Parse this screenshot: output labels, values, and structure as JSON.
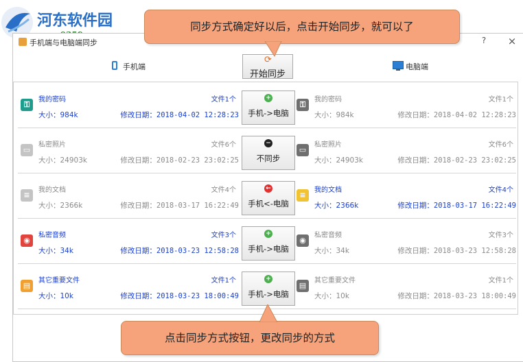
{
  "watermark": {
    "site_name": "河东软件园",
    "url": "www.pc0359.cn"
  },
  "window": {
    "title": "手机端与电脑端同步",
    "help": "?",
    "close": "×"
  },
  "header": {
    "phone_label": "手机端",
    "start_button": "开始同步",
    "pc_label": "电脑端"
  },
  "callouts": {
    "top": "同步方式确定好以后，点击开始同步，就可以了",
    "bottom": "点击同步方式按钮，更改同步的方式"
  },
  "colors": {
    "active_text": "#1a3fd0",
    "inactive_text": "#8a8a8a",
    "callout": "#f6a27a"
  },
  "rows": [
    {
      "left": {
        "name": "我的密码",
        "count": "文件1个",
        "size": "大小：984k",
        "date": "修改日期：2018-04-02 12:28:23",
        "active": true,
        "icon": "key-icon"
      },
      "sync": {
        "label": "手机->电脑",
        "icon": "plus-icon"
      },
      "right": {
        "name": "我的密码",
        "count": "文件1个",
        "size": "大小：984k",
        "date": "修改日期：2018-04-02 12:28:23",
        "active": false,
        "icon": "key-icon"
      }
    },
    {
      "left": {
        "name": "私密照片",
        "count": "文件6个",
        "size": "大小：24903k",
        "date": "修改日期：2018-02-23 23:02:25",
        "active": false,
        "icon": "photo-icon"
      },
      "sync": {
        "label": "不同步",
        "icon": "minus-icon"
      },
      "right": {
        "name": "私密照片",
        "count": "文件6个",
        "size": "大小：24903k",
        "date": "修改日期：2018-02-23 23:02:25",
        "active": false,
        "icon": "photo-icon"
      }
    },
    {
      "left": {
        "name": "我的文档",
        "count": "文件4个",
        "size": "大小：2366k",
        "date": "修改日期：2018-03-17 16:22:49",
        "active": false,
        "icon": "document-icon"
      },
      "sync": {
        "label": "手机<-电脑",
        "icon": "arrow-left-icon"
      },
      "right": {
        "name": "我的文档",
        "count": "文件4个",
        "size": "大小：2366k",
        "date": "修改日期：2018-03-17 16:22:49",
        "active": true,
        "icon": "document-icon"
      }
    },
    {
      "left": {
        "name": "私密音频",
        "count": "文件3个",
        "size": "大小：34k",
        "date": "修改日期：2018-03-23 12:58:28",
        "active": true,
        "icon": "audio-icon"
      },
      "sync": {
        "label": "手机->电脑",
        "icon": "plus-icon"
      },
      "right": {
        "name": "私密音频",
        "count": "文件3个",
        "size": "大小：34k",
        "date": "修改日期：2018-03-23 12:58:28",
        "active": false,
        "icon": "audio-icon"
      }
    },
    {
      "left": {
        "name": "其它重要文件",
        "count": "文件1个",
        "size": "大小：10k",
        "date": "修改日期：2018-03-23 18:00:49",
        "active": true,
        "icon": "file-icon"
      },
      "sync": {
        "label": "手机->电脑",
        "icon": "plus-icon"
      },
      "right": {
        "name": "其它重要文件",
        "count": "文件1个",
        "size": "大小：10k",
        "date": "修改日期：2018-03-23 18:00:49",
        "active": false,
        "icon": "file-icon"
      }
    }
  ]
}
